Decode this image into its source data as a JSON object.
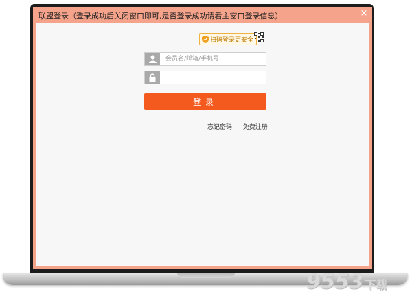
{
  "window": {
    "title": "联盟登录（登录成功后关闭窗口即可,是否登录成功请看主窗口登录信息）",
    "close_label": "×"
  },
  "qr_tip": {
    "label": "扫码登录更安全",
    "icon": "shield-icon"
  },
  "form": {
    "username_placeholder": "会员名/邮箱/手机号",
    "username_value": "",
    "password_value": "",
    "login_label": "登录",
    "forgot_label": "忘记密码",
    "register_label": "免费注册"
  },
  "colors": {
    "window_frame": "#f5a38a",
    "login_button": "#f45a1d",
    "tip_border": "#f0b240"
  },
  "watermark": {
    "number": "9553",
    "text": "下载"
  }
}
